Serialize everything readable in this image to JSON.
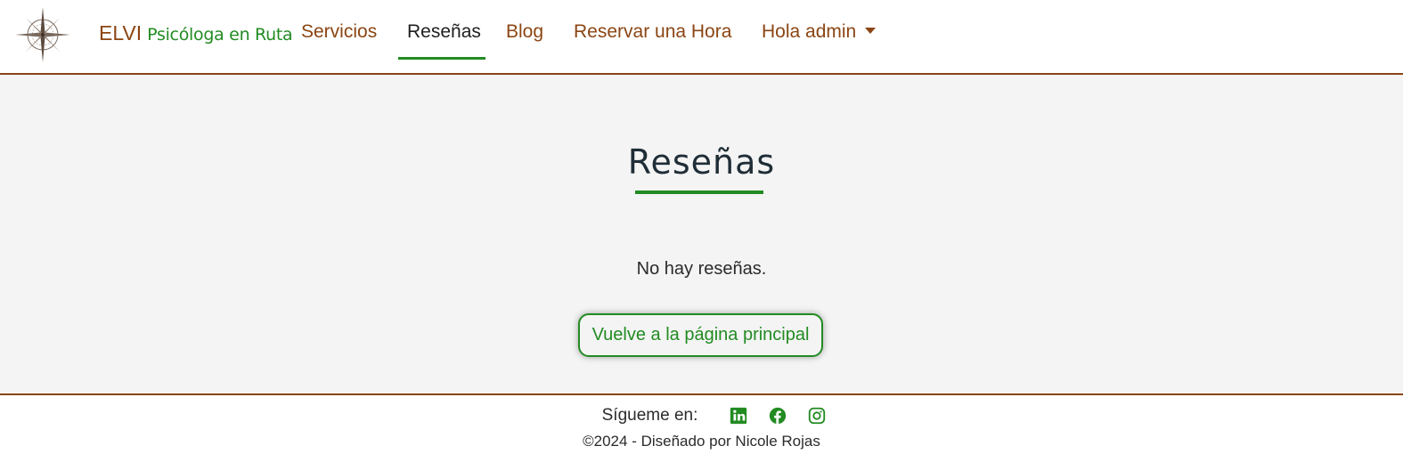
{
  "brand": {
    "name": "ELVI",
    "subtitle": "Psicóloga en Ruta"
  },
  "nav": {
    "items": [
      {
        "label": "Servicios",
        "active": false
      },
      {
        "label": "Reseñas",
        "active": true
      },
      {
        "label": "Blog",
        "active": false
      },
      {
        "label": "Reservar una Hora",
        "active": false
      }
    ],
    "user_menu": "Hola admin"
  },
  "main": {
    "title": "Reseñas",
    "empty_message": "No hay reseñas.",
    "home_button": "Vuelve a la página principal"
  },
  "footer": {
    "follow_label": "Sígueme en:",
    "social_icons": [
      "linkedin-icon",
      "facebook-icon",
      "instagram-icon"
    ],
    "copyright": "©2024 - Diseñado por Nicole Rojas"
  },
  "colors": {
    "brand_brown": "#8b4513",
    "accent_green": "#228b22",
    "background": "#f4f4f4",
    "title_dark": "#1f2d36"
  }
}
